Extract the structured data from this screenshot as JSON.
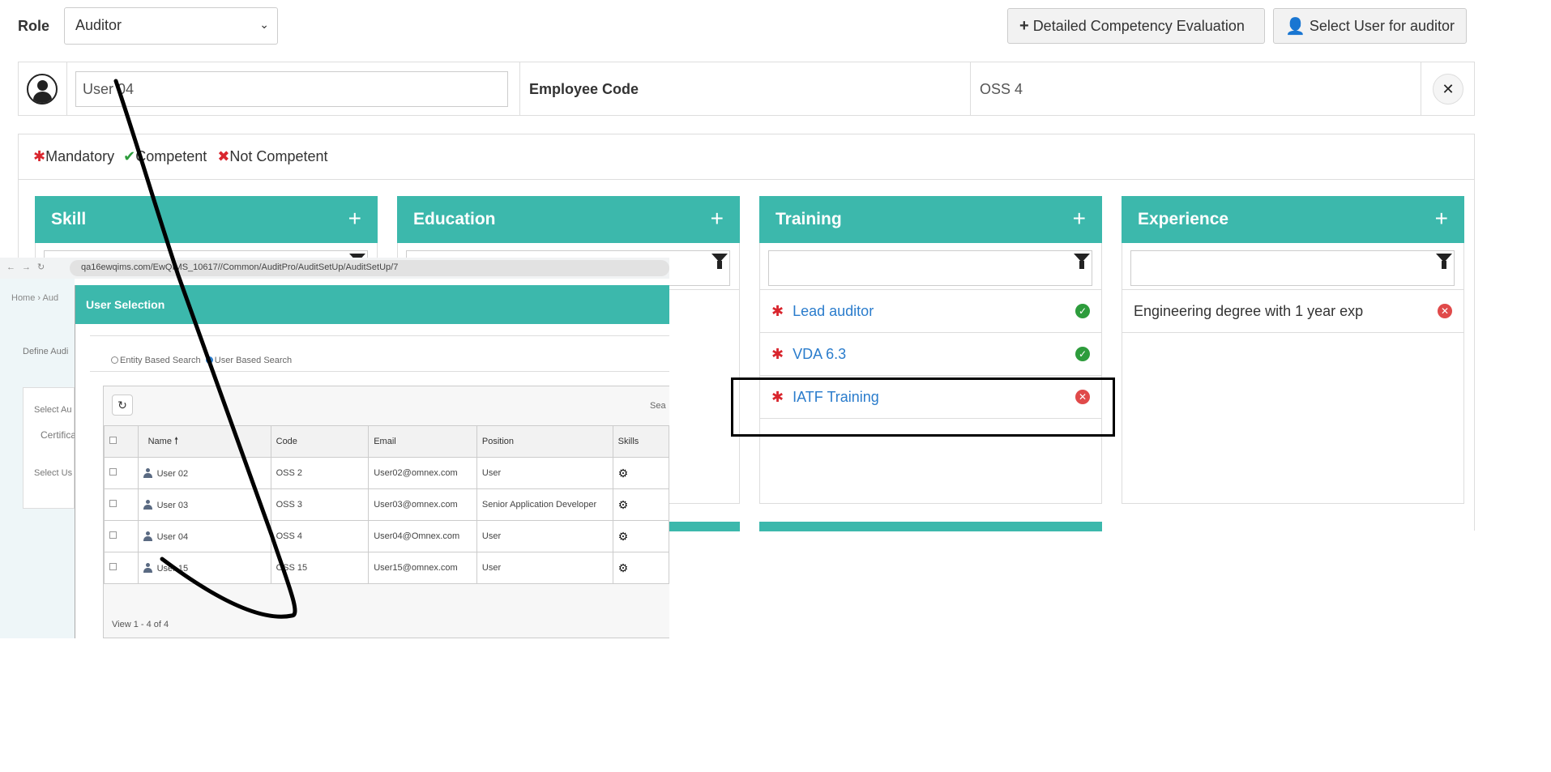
{
  "role": {
    "label": "Role",
    "selected": "Auditor"
  },
  "actions": {
    "detailed_label": "Detailed Competency Evaluation",
    "select_user_label": "Select User for auditor"
  },
  "user": {
    "name": "User 04",
    "employee_code_label": "Employee Code",
    "employee_code": "OSS 4"
  },
  "legend": {
    "mandatory": "Mandatory",
    "competent": "Competent",
    "not_competent": "Not Competent"
  },
  "cards": [
    {
      "title": "Skill",
      "items": []
    },
    {
      "title": "Education",
      "items": []
    },
    {
      "title": "Training",
      "items": [
        {
          "label": "Lead auditor",
          "mandatory": true,
          "status": "competent"
        },
        {
          "label": "VDA 6.3",
          "mandatory": true,
          "status": "competent"
        },
        {
          "label": "IATF Training",
          "mandatory": true,
          "status": "not-competent"
        }
      ]
    },
    {
      "title": "Experience",
      "items": [
        {
          "label": "Engineering degree with 1 year exp",
          "mandatory": false,
          "status": "not-competent"
        }
      ]
    }
  ],
  "inset": {
    "url": "qa16ewqims.com/EwQIMS_10617//Common/AuditPro/AuditSetUp/AuditSetUp/7",
    "breadcrumb": "Home  ›  Aud",
    "side_define": "Define Audi",
    "side_select_a": "Select Au",
    "side_value": "Certifica",
    "side_select_u": "Select Us",
    "modal_title": "User Selection",
    "search_entity": "Entity Based Search",
    "search_user": "User Based Search",
    "search_label": "Sea",
    "columns": [
      "Name",
      "Code",
      "Email",
      "Position",
      "Skills"
    ],
    "rows": [
      {
        "name": "User 02",
        "code": "OSS 2",
        "email": "User02@omnex.com",
        "position": "User"
      },
      {
        "name": "User 03",
        "code": "OSS 3",
        "email": "User03@omnex.com",
        "position": "Senior Application Developer"
      },
      {
        "name": "User 04",
        "code": "OSS 4",
        "email": "User04@Omnex.com",
        "position": "User"
      },
      {
        "name": "User 15",
        "code": "OSS 15",
        "email": "User15@omnex.com",
        "position": "User"
      }
    ],
    "pager": "View 1 - 4 of 4"
  },
  "colors": {
    "accent": "#3cb8ac",
    "competent": "#2d9c3c",
    "not_competent": "#e04a4a",
    "link": "#2a7ccc"
  }
}
